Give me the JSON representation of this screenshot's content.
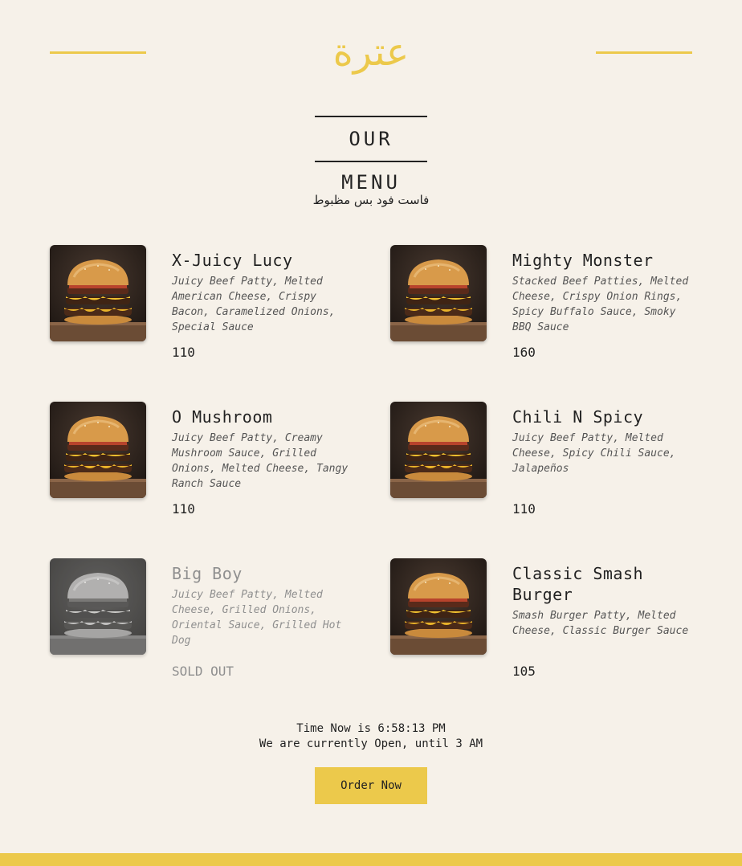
{
  "brand": {
    "logo": "عترة",
    "accent_color": "#ecc94b"
  },
  "header": {
    "title": "OUR MENU",
    "tagline": "فاست فود بس مظبوط"
  },
  "menu": [
    {
      "name": "X-Juicy Lucy",
      "description": "Juicy Beef Patty, Melted American Cheese, Crispy Bacon, Caramelized Onions, Special Sauce",
      "price": "110",
      "image_icon": "burger-icon",
      "sold_out": false
    },
    {
      "name": "Mighty Monster",
      "description": "Stacked Beef Patties, Melted Cheese, Crispy Onion Rings, Spicy Buffalo Sauce, Smoky BBQ Sauce",
      "price": "160",
      "image_icon": "burger-icon",
      "sold_out": false
    },
    {
      "name": "O Mushroom",
      "description": "Juicy Beef Patty, Creamy Mushroom Sauce, Grilled Onions, Melted Cheese, Tangy Ranch Sauce",
      "price": "110",
      "image_icon": "burger-icon",
      "sold_out": false
    },
    {
      "name": "Chili N Spicy",
      "description": "Juicy Beef Patty, Melted Cheese, Spicy Chili Sauce, Jalapeños",
      "price": "110",
      "image_icon": "burger-icon",
      "sold_out": false
    },
    {
      "name": "Big Boy",
      "description": "Juicy Beef Patty, Melted Cheese, Grilled Onions, Oriental Sauce, Grilled Hot Dog",
      "price": "SOLD OUT",
      "image_icon": "burger-icon",
      "sold_out": true
    },
    {
      "name": "Classic Smash Burger",
      "description": "Smash Burger Patty, Melted Cheese, Classic Burger Sauce",
      "price": "105",
      "image_icon": "burger-icon",
      "sold_out": false
    }
  ],
  "status": {
    "time_line": "Time Now is 6:58:13 PM",
    "open_line": "We are currently Open, until 3 AM"
  },
  "cta": {
    "order_label": "Order Now"
  }
}
